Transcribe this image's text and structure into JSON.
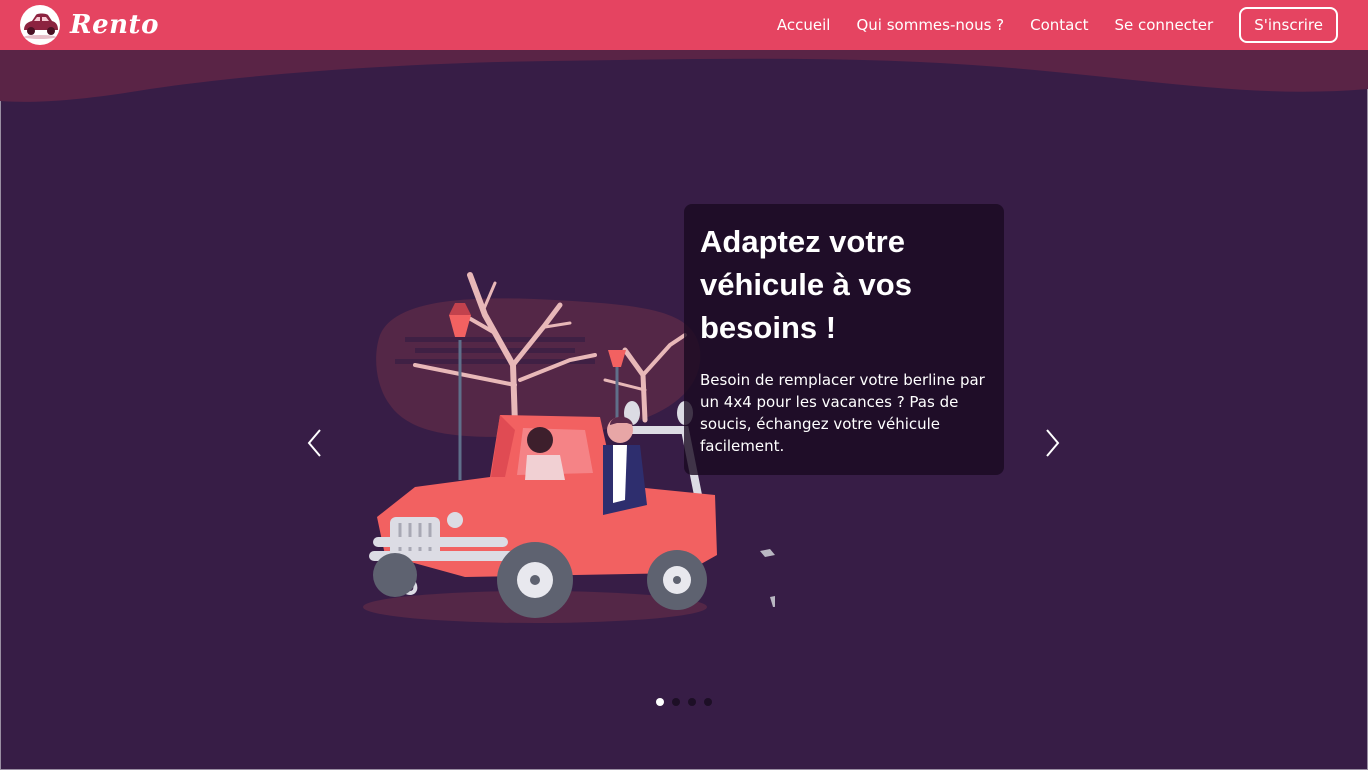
{
  "brand": {
    "name": "Rento",
    "logo_icon": "car-logo-icon"
  },
  "nav": {
    "items": [
      {
        "label": "Accueil"
      },
      {
        "label": "Qui sommes-nous ?"
      },
      {
        "label": "Contact"
      },
      {
        "label": "Se connecter"
      }
    ],
    "signup_label": "S'inscrire"
  },
  "carousel": {
    "slides": [
      {
        "title": "Adaptez votre véhicule à vos besoins !",
        "text": "Besoin de remplacer votre berline par un 4x4 pour les vacances ? Pas de soucis, échangez votre véhicule facilement."
      }
    ],
    "slide_count": 4,
    "active_index": 0,
    "prev_icon": "chevron-left-icon",
    "next_icon": "chevron-right-icon"
  },
  "colors": {
    "navbar": "#e54461",
    "background": "#371d46",
    "jeep": "#f26161"
  }
}
